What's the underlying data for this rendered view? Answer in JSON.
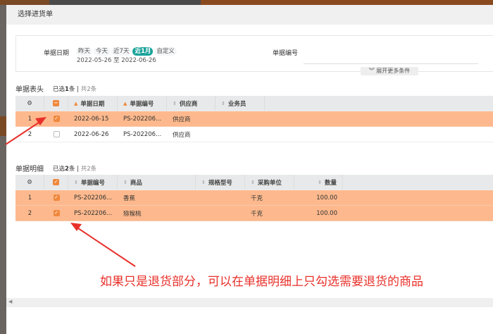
{
  "dialog": {
    "title": "选择进货单"
  },
  "filter": {
    "date_label": "单据日期",
    "date_chips": [
      "昨天",
      "今天",
      "近7天",
      "近1月",
      "自定义"
    ],
    "active_chip": "近1月",
    "date_range": "2022-05-26 至 2022-06-26",
    "number_label": "单据编号",
    "number_value": "",
    "expand_label": "展开更多条件"
  },
  "header_table": {
    "title": "单据表头",
    "selected_prefix": "已选",
    "selected_count": "1",
    "selected_suffix": "条",
    "total": "共2条",
    "columns": [
      "单据日期",
      "单据编号",
      "供应商",
      "业务员"
    ],
    "rows": [
      {
        "index": "1",
        "checked": true,
        "date": "2022-06-15",
        "number": "PS-202206...",
        "supplier": "供应商",
        "salesman": ""
      },
      {
        "index": "2",
        "checked": false,
        "date": "2022-06-26",
        "number": "PS-202206...",
        "supplier": "供应商",
        "salesman": ""
      }
    ]
  },
  "detail_table": {
    "title": "单据明细",
    "selected_prefix": "已选",
    "selected_count": "2",
    "selected_suffix": "条",
    "total": "共2条",
    "columns": [
      "单据编号",
      "商品",
      "规格型号",
      "采购单位",
      "数量"
    ],
    "rows": [
      {
        "index": "1",
        "checked": true,
        "number": "PS-202206...",
        "product": "香蕉",
        "spec": "",
        "unit": "千克",
        "qty": "100.00"
      },
      {
        "index": "2",
        "checked": true,
        "number": "PS-202206...",
        "product": "猕猴桃",
        "spec": "",
        "unit": "千克",
        "qty": "100.00"
      }
    ]
  },
  "annotation": "如果只是退货部分，可以在单据明细上只勾选需要退货的商品",
  "colors": {
    "selected_row": "#fdb98d",
    "accent": "#f0883c",
    "chip_active": "#1aa39a",
    "annotation": "#e8302a"
  }
}
